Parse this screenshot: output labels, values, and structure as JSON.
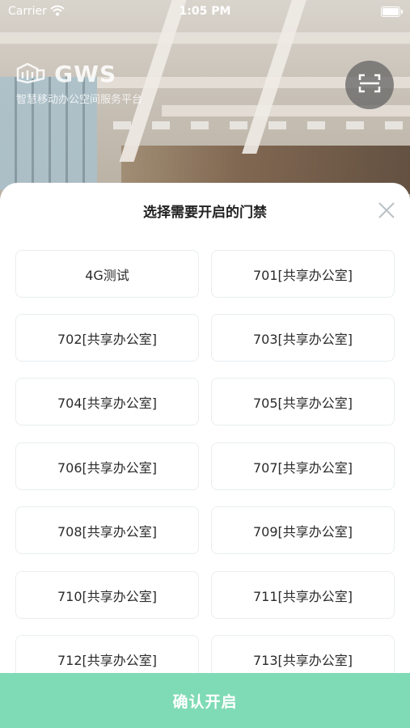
{
  "status_bar": {
    "carrier": "Carrier",
    "time": "1:05 PM"
  },
  "brand": {
    "name": "GWS",
    "subtitle": "智慧移动办公空间服务平台"
  },
  "sheet": {
    "title": "选择需要开启的门禁",
    "doors": [
      "4G测试",
      "701[共享办公室]",
      "702[共享办公室]",
      "703[共享办公室]",
      "704[共享办公室]",
      "705[共享办公室]",
      "706[共享办公室]",
      "707[共享办公室]",
      "708[共享办公室]",
      "709[共享办公室]",
      "710[共享办公室]",
      "711[共享办公室]",
      "712[共享办公室]",
      "713[共享办公室]"
    ]
  },
  "confirm_label": "确认开启",
  "colors": {
    "accent": "#7fdbb5",
    "card_border": "#e9eef0"
  },
  "icons": {
    "scan": "scan-icon",
    "close": "close-icon",
    "wifi": "wifi-icon",
    "battery": "battery-icon",
    "logo": "gws-logo-icon"
  }
}
